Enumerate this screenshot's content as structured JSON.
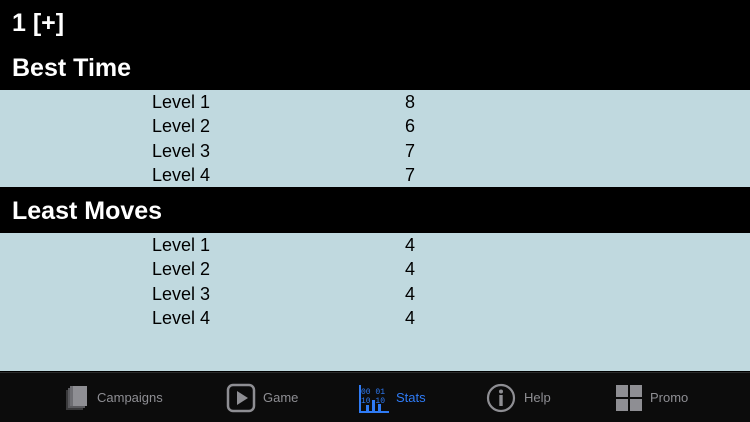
{
  "header": {
    "title": "1 [+]"
  },
  "best_time": {
    "title": "Best Time",
    "rows": [
      {
        "level": "Level 1",
        "value": "8"
      },
      {
        "level": "Level 2",
        "value": "6"
      },
      {
        "level": "Level 3",
        "value": "7"
      },
      {
        "level": "Level 4",
        "value": "7"
      }
    ]
  },
  "least_moves": {
    "title": "Least Moves",
    "rows": [
      {
        "level": "Level 1",
        "value": "4"
      },
      {
        "level": "Level 2",
        "value": "4"
      },
      {
        "level": "Level 3",
        "value": "4"
      },
      {
        "level": "Level 4",
        "value": "4"
      }
    ]
  },
  "tabbar": {
    "tabs": [
      {
        "label": "Campaigns",
        "icon": "book-icon",
        "active": false
      },
      {
        "label": "Game",
        "icon": "play-icon",
        "active": false
      },
      {
        "label": "Stats",
        "icon": "stats-icon",
        "active": true,
        "icon_text_top": "00 01",
        "icon_text_bottom": "10 10"
      },
      {
        "label": "Help",
        "icon": "info-icon",
        "active": false
      },
      {
        "label": "Promo",
        "icon": "grid-icon",
        "active": false
      }
    ]
  },
  "colors": {
    "background": "#000000",
    "panel": "#c0d9df",
    "tab_inactive": "#8e8e93",
    "tab_active": "#2f7bf5"
  }
}
